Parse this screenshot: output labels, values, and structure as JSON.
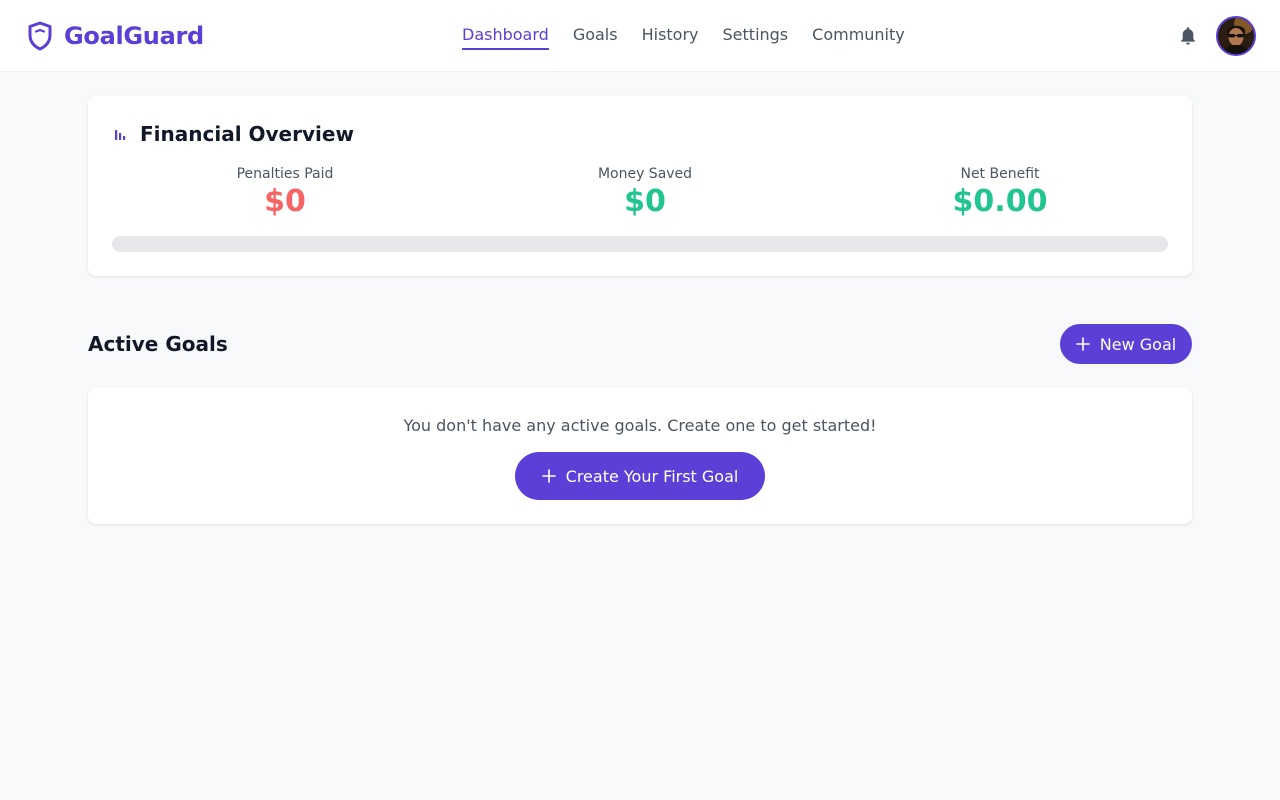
{
  "header": {
    "brand_name": "GoalGuard",
    "nav": [
      {
        "label": "Dashboard",
        "active": true
      },
      {
        "label": "Goals",
        "active": false
      },
      {
        "label": "History",
        "active": false
      },
      {
        "label": "Settings",
        "active": false
      },
      {
        "label": "Community",
        "active": false
      }
    ],
    "icons": {
      "logo": "shield-icon",
      "notifications": "bell-icon",
      "profile": "avatar"
    }
  },
  "overview": {
    "title": "Financial Overview",
    "icon": "bar-chart-icon",
    "stats": [
      {
        "label": "Penalties Paid",
        "value": "$0",
        "color": "#f56565"
      },
      {
        "label": "Money Saved",
        "value": "$0",
        "color": "#22c58f"
      },
      {
        "label": "Net Benefit",
        "value": "$0.00",
        "color": "#22c58f"
      }
    ],
    "progress_percent": 0
  },
  "active_goals": {
    "title": "Active Goals",
    "new_goal_label": "New Goal",
    "empty_message": "You don't have any active goals. Create one to get started!",
    "create_first_label": "Create Your First Goal"
  },
  "colors": {
    "accent": "#5b3fd6",
    "penalty": "#f56565",
    "saved": "#22c58f",
    "track": "#e5e7eb",
    "page_background": "#f8f9fb"
  }
}
